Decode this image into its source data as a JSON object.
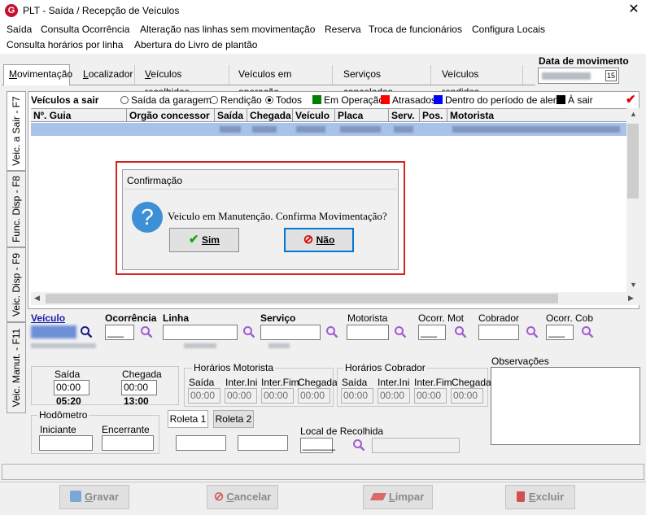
{
  "window": {
    "title": "PLT - Saída / Recepção de Veículos",
    "logo_letter": "G",
    "close_glyph": "✕"
  },
  "menu": [
    "Saída",
    "Consulta Ocorrência",
    "Alteração nas linhas sem movimentação",
    "Reserva",
    "Troca de funcionários",
    "Configura Locais",
    "Consulta horários por linha",
    "Abertura do Livro de plantão"
  ],
  "tabs": [
    {
      "pre": "",
      "u": "M",
      "post": "ovimentação"
    },
    {
      "pre": "",
      "u": "L",
      "post": "ocalizador"
    },
    {
      "pre": "",
      "u": "V",
      "post": "eículos recolhidos"
    },
    {
      "pre": "Veículos em ",
      "u": "o",
      "post": "peração"
    },
    {
      "pre": "Serviços ",
      "u": "c",
      "post": "ancelados"
    },
    {
      "pre": "Veículos rendidos",
      "u": "",
      "post": ""
    }
  ],
  "date": {
    "label": "Data de movimento",
    "cal_glyph": "15"
  },
  "vtabs": [
    "Veic. a Sair - F7",
    "Func. Disp - F8",
    "Veic. Disp - F9",
    "Veic. Manut. - F11"
  ],
  "filter": {
    "title": "Veículos a sair",
    "options": [
      "Saída da garagem",
      "Rendição",
      "Todos"
    ],
    "legend": [
      {
        "label": "Em Operação",
        "color": "#008000"
      },
      {
        "label": "Atrasados",
        "color": "#ff0000"
      },
      {
        "label": "Dentro do período de alerta",
        "color": "#0000ff"
      },
      {
        "label": "À sair",
        "color": "#000000"
      }
    ],
    "check_glyph": "✔"
  },
  "grid": {
    "columns": [
      "Nº. Guia",
      "Orgão concessor",
      "Saída",
      "Chegada",
      "Veículo",
      "Placa",
      "Serv.",
      "Pos.",
      "Motorista"
    ]
  },
  "dialog": {
    "title": "Confirmação",
    "icon_glyph": "?",
    "message": "Veiculo em Manutenção. Confirma Movimentação?",
    "yes": {
      "glyph": "✔",
      "label": "Sim"
    },
    "no": {
      "glyph": "⊘",
      "label": "Não"
    }
  },
  "form": {
    "veiculo": "Veículo",
    "ocorrencia": "Ocorrência",
    "linha": "Linha",
    "servico": "Serviço",
    "motorista": "Motorista",
    "ocorr_mot": "Ocorr. Mot",
    "cobrador": "Cobrador",
    "ocorr_cob": "Ocorr. Cob",
    "ocorrencia_value": "___",
    "ocorr_mot_value": "___",
    "ocorr_cob_value": "___",
    "saida": "Saída",
    "chegada": "Chegada",
    "saida_value": "00:00",
    "chegada_value": "00:00",
    "saida_time": "05:20",
    "chegada_time": "13:00",
    "hor_mot": "Horários Motorista",
    "hor_cob": "Horários Cobrador",
    "h_saida": "Saída",
    "h_ini": "Inter.Ini",
    "h_fim": "Inter.Fim",
    "h_chegada": "Chegada",
    "h_zero": "00:00",
    "observacoes": "Observações",
    "hodometro": "Hodômetro",
    "iniciante": "Iniciante",
    "encerrante": "Encerrante",
    "roleta1": "Roleta 1",
    "roleta2": "Roleta 2",
    "local_recolhida": "Local de Recolhida",
    "local_value": "______"
  },
  "buttons": [
    {
      "u": "G",
      "rest": "ravar"
    },
    {
      "u": "C",
      "rest": "ancelar"
    },
    {
      "u": "L",
      "rest": "impar"
    },
    {
      "u": "E",
      "rest": "xcluir"
    }
  ]
}
